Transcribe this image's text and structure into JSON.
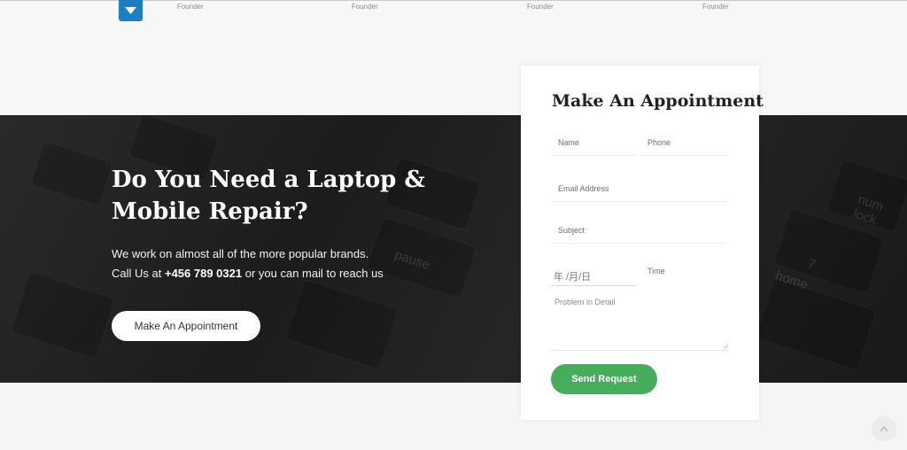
{
  "top": {
    "founders": [
      "Founder",
      "Founder",
      "Founder",
      "Founder"
    ]
  },
  "hero": {
    "heading_line1": "Do You Need a Laptop &",
    "heading_line2": "Mobile Repair?",
    "text_line1": "We work on almost all of the more popular brands.",
    "call_prefix": "Call Us at",
    "phone": "+456 789 0321",
    "call_suffix": "or you can mail to reach us",
    "button_label": "Make An Appointment",
    "keyboard_keys": [
      "num lock",
      "pause",
      "home",
      "7"
    ]
  },
  "form": {
    "title": "Make An Appointment",
    "name_placeholder": "Name",
    "phone_placeholder": "Phone",
    "email_placeholder": "Email Address",
    "subject_placeholder": "Subject",
    "date_placeholder": "年 /月/日",
    "time_placeholder": "Time",
    "problem_placeholder": "Problem in Detail",
    "submit_label": "Send Request"
  },
  "icons": {
    "dropdown": "chevron-down-icon",
    "scroll_top": "arrow-up-icon"
  },
  "colors": {
    "accent_green": "#45ad5b",
    "accent_blue": "#1d7fc1",
    "hero_bg": "#1f1f1f"
  }
}
